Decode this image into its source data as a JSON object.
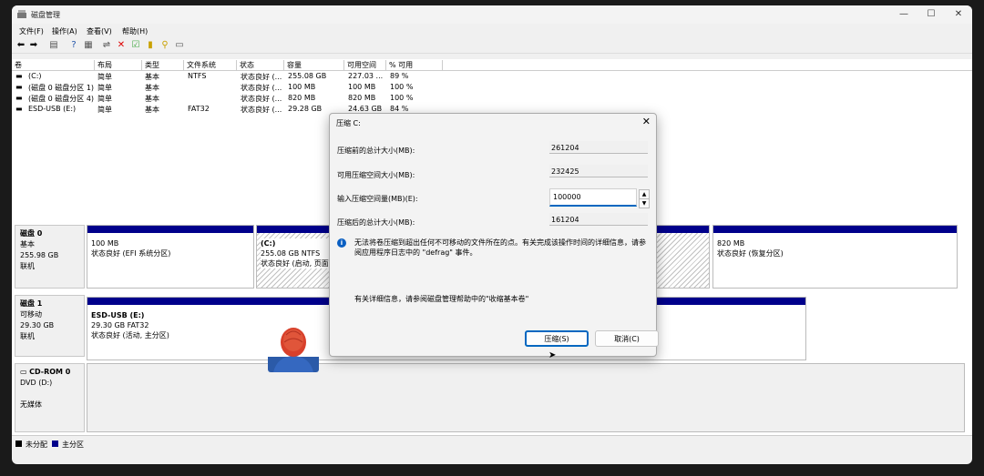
{
  "window": {
    "title": "磁盘管理",
    "controls": [
      "—",
      "☐",
      "✕"
    ]
  },
  "menu": [
    "文件(F)",
    "操作(A)",
    "查看(V)",
    "帮助(H)"
  ],
  "volume_columns": [
    "卷",
    "布局",
    "类型",
    "文件系统",
    "状态",
    "容量",
    "可用空间",
    "% 可用"
  ],
  "volumes": [
    [
      "(C:)",
      "简单",
      "基本",
      "NTFS",
      "状态良好 (...",
      "255.08 GB",
      "227.03 ...",
      "89 %"
    ],
    [
      "(磁盘 0 磁盘分区 1)",
      "简单",
      "基本",
      "",
      "状态良好 (...",
      "100 MB",
      "100 MB",
      "100 %"
    ],
    [
      "(磁盘 0 磁盘分区 4)",
      "简单",
      "基本",
      "",
      "状态良好 (...",
      "820 MB",
      "820 MB",
      "100 %"
    ],
    [
      "ESD-USB (E:)",
      "简单",
      "基本",
      "FAT32",
      "状态良好 (...",
      "29.28 GB",
      "24.63 GB",
      "84 %"
    ]
  ],
  "disks": [
    {
      "name": "磁盘 0",
      "type": "基本",
      "size": "255.98 GB",
      "status": "联机"
    },
    {
      "name": "磁盘 1",
      "type": "可移动",
      "size": "29.30 GB",
      "status": "联机"
    },
    {
      "name": "CD-ROM 0",
      "type": "DVD (D:)",
      "size": "",
      "status": "无媒体"
    }
  ],
  "partitions": {
    "d0p1": {
      "line1": "100 MB",
      "line2": "状态良好 (EFI 系统分区)"
    },
    "d0c": {
      "title": "(C:)",
      "line1": "255.08 GB NTFS",
      "line2": "状态良好 (启动, 页面"
    },
    "d0p4": {
      "line1": "820 MB",
      "line2": "状态良好 (恢复分区)"
    },
    "d1": {
      "title": "ESD-USB  (E:)",
      "line1": "29.30 GB FAT32",
      "line2": "状态良好 (活动, 主分区)"
    }
  },
  "legend": {
    "unallocated": "未分配",
    "primary": "主分区"
  },
  "dialog": {
    "title": "压缩 C:",
    "labels": [
      "压缩前的总计大小(MB):",
      "可用压缩空间大小(MB):",
      "输入压缩空间量(MB)(E):",
      "压缩后的总计大小(MB):"
    ],
    "total_before": "261204",
    "available": "232425",
    "input_value": "100000",
    "total_after": "161204",
    "info": "无法将卷压缩到超出任何不可移动的文件所在的点。有关完成该操作时间的详细信息，请参阅应用程序日志中的 \"defrag\" 事件。",
    "help": "有关详细信息，请参阅磁盘管理帮助中的\"收缩基本卷\"",
    "shrink_button": "压缩(S)",
    "cancel_button": "取消(C)"
  },
  "colors": {
    "primary_partition": "#00008b",
    "unallocated": "#000000",
    "accent": "#0067c0"
  }
}
